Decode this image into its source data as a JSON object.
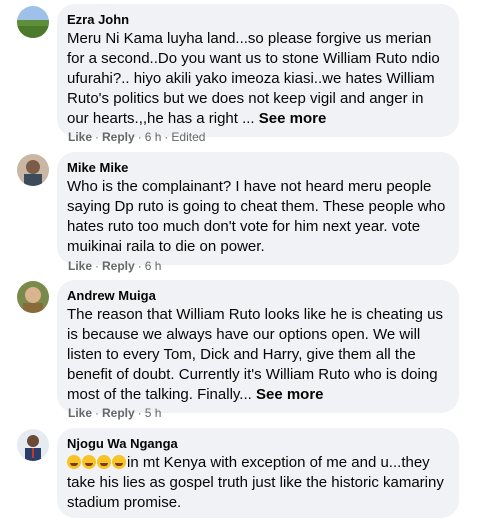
{
  "comments": [
    {
      "author": "Ezra John",
      "text": "Meru Ni Kama luyha land...so please forgive us merian for a second..Do you want us to stone William Ruto ndio ufurahi?.. hiyo akili yako imeoza kiasi..we hates William Ruto's politics but we does not keep vigil and anger in our hearts.,,he has a right ...",
      "see_more": "See more",
      "like": "Like",
      "reply": "Reply",
      "time": "6 h",
      "edited": "Edited"
    },
    {
      "author": "Mike Mike",
      "text": "Who is the complainant? I have not heard meru people saying Dp ruto is going to cheat them. These people who hates ruto too much don't vote for him next year. vote muikinai raila to die on power.",
      "like": "Like",
      "reply": "Reply",
      "time": "6 h"
    },
    {
      "author": "Andrew Muiga",
      "text": "The reason that William Ruto looks like he is cheating us is because we always have our options open. We will listen to every Tom, Dick and Harry, give them all the benefit of doubt. Currently it's William Ruto who is doing most of the talking. Finally...",
      "see_more": "See more",
      "like": "Like",
      "reply": "Reply",
      "time": "5 h"
    },
    {
      "author": "Njogu Wa Nganga",
      "text": "in mt Kenya with exception of me and u...they take his lies as gospel truth just like the historic kamariny stadium promise."
    }
  ],
  "separator": "·"
}
